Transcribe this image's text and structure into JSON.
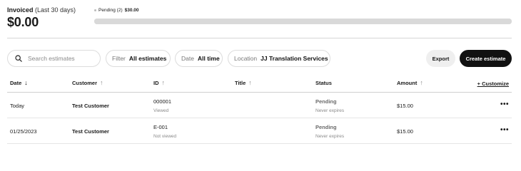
{
  "summary": {
    "title": "Invoiced",
    "period": "(Last 30 days)",
    "amount": "$0.00",
    "pending_label": "Pending (2)",
    "pending_amount": "$30.00"
  },
  "filters": {
    "search_placeholder": "Search estimates",
    "filter_key": "Filter",
    "filter_value": "All estimates",
    "date_key": "Date",
    "date_value": "All time",
    "location_key": "Location",
    "location_value": "JJ Translation Services",
    "export_label": "Export",
    "create_label": "Create estimate"
  },
  "table": {
    "columns": {
      "date": "Date",
      "customer": "Customer",
      "id": "ID",
      "title": "Title",
      "status": "Status",
      "amount": "Amount",
      "customize": "+ Customize"
    },
    "rows": [
      {
        "date": "Today",
        "customer": "Test Customer",
        "id": "000001",
        "id_sub": "Viewed",
        "title": "",
        "status": "Pending",
        "status_sub": "Never expires",
        "amount": "$15.00"
      },
      {
        "date": "01/25/2023",
        "customer": "Test Customer",
        "id": "E-001",
        "id_sub": "Not viewed",
        "title": "",
        "status": "Pending",
        "status_sub": "Never expires",
        "amount": "$15.00"
      }
    ]
  },
  "icons": {
    "search": "search-icon",
    "sort_down": "arrow-down-icon",
    "sort_up": "arrow-up-icon",
    "more": "more-horizontal-icon"
  }
}
